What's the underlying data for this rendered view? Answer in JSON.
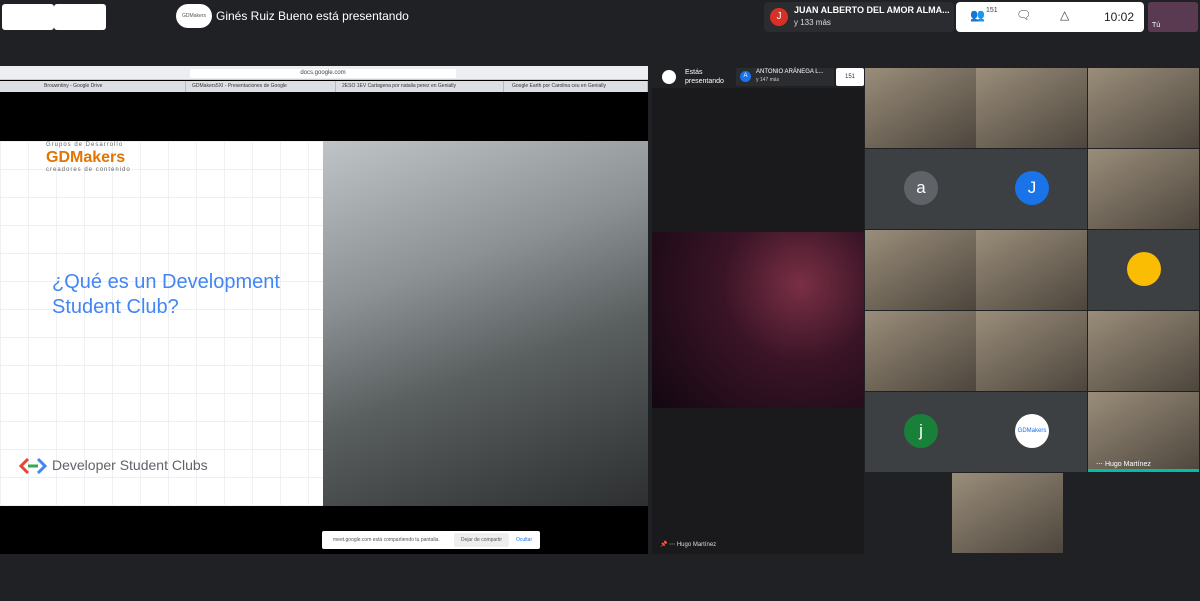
{
  "topbar": {
    "presenting_text": "Ginés Ruiz Bueno está presentando",
    "presenter_logo": "GDMakers",
    "speaker_initial": "J",
    "speaker_name": "JUAN ALBERTO DEL AMOR ALMA...",
    "speaker_more": "y 133 más",
    "participants_count": "151",
    "clock": "10:02",
    "self_label": "Tú",
    "colors": {
      "speaker_avatar": "#d93025",
      "active_tile": "#00bfa5"
    }
  },
  "browser": {
    "url": "docs.google.com",
    "tabs": [
      "Brouwntiny - Google Drive",
      "GDMakers5XI - Presentaciones de Google",
      "2ESO 1EV Cartagena por natalia perez en Genially",
      "Google Earth por Carolina ceu en Genially"
    ]
  },
  "slide": {
    "grupos": "Grupos de Desarrollo",
    "brand": "GDMakers",
    "brand_sub": "creadores de contenido",
    "title": "¿Qué es un Development Student Club?",
    "footer_label": "Developer Student Clubs"
  },
  "share_notice": {
    "text": "meet.google.com está compartiendo tu pantalla.",
    "stop": "Dejar de compartir",
    "hide": "Ocultar"
  },
  "middle": {
    "estas": "Estás",
    "presentando": "presentando",
    "chip_initial": "A",
    "chip_name": "ANTONIO ARÁNEGA L...",
    "chip_more": "y 147 más",
    "people": "151",
    "footer_name": "Hugo Martínez"
  },
  "grid": [
    {
      "type": "video",
      "name": ""
    },
    {
      "type": "video",
      "name": ""
    },
    {
      "type": "video",
      "name": ""
    },
    {
      "type": "avatar",
      "initial": "a",
      "color": "#5f6368"
    },
    {
      "type": "avatar",
      "initial": "J",
      "color": "#1a73e8"
    },
    {
      "type": "video",
      "name": ""
    },
    {
      "type": "video",
      "name": ""
    },
    {
      "type": "video",
      "name": ""
    },
    {
      "type": "avatar",
      "initial": "",
      "color": "#fbbc04"
    },
    {
      "type": "video",
      "name": ""
    },
    {
      "type": "video",
      "name": ""
    },
    {
      "type": "video",
      "name": ""
    },
    {
      "type": "avatar",
      "initial": "j",
      "color": "#188038"
    },
    {
      "type": "logo",
      "initial": "GDMakers",
      "color": "#ffffff"
    },
    {
      "type": "video",
      "name": "Hugo Martínez"
    },
    {
      "type": "video",
      "name": ""
    }
  ]
}
